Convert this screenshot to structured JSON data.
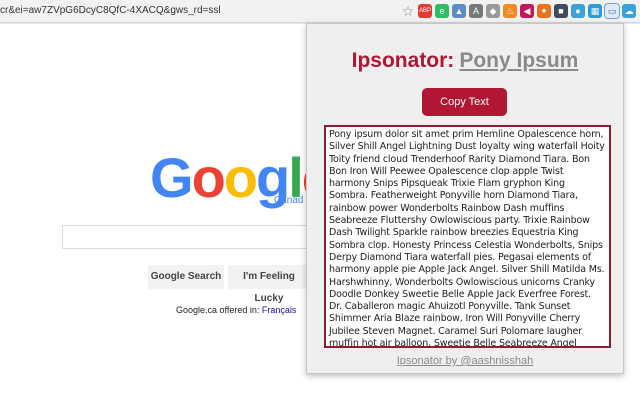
{
  "browser": {
    "url": "cr&ei=aw7ZVpG6DcyC8QfC-4XACQ&gws_rd=ssl",
    "extensions": [
      {
        "name": "star-icon",
        "glyph": "☆",
        "color": "#888888"
      },
      {
        "name": "abp-icon",
        "glyph": "ABP",
        "color": "#e53935"
      },
      {
        "name": "evernote-icon",
        "glyph": "e",
        "color": "#2dbe60"
      },
      {
        "name": "chart-icon",
        "glyph": "▲",
        "color": "#5b8cc8"
      },
      {
        "name": "angular-icon",
        "glyph": "A",
        "color": "#777777"
      },
      {
        "name": "lock-icon",
        "glyph": "◆",
        "color": "#999999"
      },
      {
        "name": "flame-icon",
        "glyph": "♨",
        "color": "#f08a24"
      },
      {
        "name": "tag-icon",
        "glyph": "◀",
        "color": "#c2185b"
      },
      {
        "name": "fox-icon",
        "glyph": "✦",
        "color": "#e8711a"
      },
      {
        "name": "owl-icon",
        "glyph": "■",
        "color": "#3d4b5c"
      },
      {
        "name": "shield-icon",
        "glyph": "●",
        "color": "#3aa3d6"
      },
      {
        "name": "image-icon",
        "glyph": "▦",
        "color": "#2f9ad4"
      },
      {
        "name": "ipsonator-icon",
        "glyph": "▭",
        "color": "#3a6ea5"
      },
      {
        "name": "weather-icon",
        "glyph": "☁",
        "color": "#3aa3d6"
      }
    ]
  },
  "google": {
    "logo_letters": [
      {
        "char": "G",
        "color": "#4285f4"
      },
      {
        "char": "o",
        "color": "#ea4335"
      },
      {
        "char": "o",
        "color": "#fbbc05"
      },
      {
        "char": "g",
        "color": "#4285f4"
      },
      {
        "char": "l",
        "color": "#34a853"
      },
      {
        "char": "e",
        "color": "#ea4335"
      }
    ],
    "region": "Canad",
    "search_button": "Google Search",
    "lucky_button": "I'm Feeling Lucky",
    "offered_in": "Google.ca offered in:",
    "language_link": "Français"
  },
  "popup": {
    "title_main": "Ipsonator:",
    "title_sub": "Pony Ipsum",
    "copy_button": "Copy Text",
    "ipsum_text": "Pony ipsum dolor sit amet prim Hemline Opalescence horn, Silver Shill Angel Lightning Dust loyalty wing waterfall Hoity Toity friend cloud Trenderhoof Rarity Diamond Tiara.   Bon Bon Iron Will Peewee Opalescence clop apple Twist harmony Snips Pipsqueak Trixie Flam gryphon King Sombra.  Featherweight Ponyville horn Diamond Tiara, rainbow power Wonderbolts Rainbow Dash muffins Seabreeze Fluttershy Owlowiscious party. Trixie Rainbow Dash Twilight Sparkle rainbow breezies Equestria King Sombra clop. Honesty Princess Celestia Wonderbolts, Snips Derpy Diamond Tiara waterfall pies.  Pegasai elements of harmony apple pie Apple Jack Angel.  Silver Shill Matilda Ms. Harshwhinny, Wonderbolts Owlowiscious unicorns Cranky Doodle Donkey Sweetie Belle Apple Jack Everfree Forest.  Dr. Caballeron magic Ahuizotl Ponyville.  Tank Sunset Shimmer Aria Blaze rainbow, Iron Will Ponyville Cherry Jubilee Steven Magnet. Caramel Suri Polomare laugher muffin hot air balloon, Sweetie Belle Seabreeze Angel Winona muffins party Apple Jack Opalescence.  Prim Hemline Wonderbolts Daring Do Photo Finish gryphon Twist Scootaloo Granny Smith Aria Blaze Nightmare",
    "credit": "Ipsonator by @aashnisshah"
  }
}
